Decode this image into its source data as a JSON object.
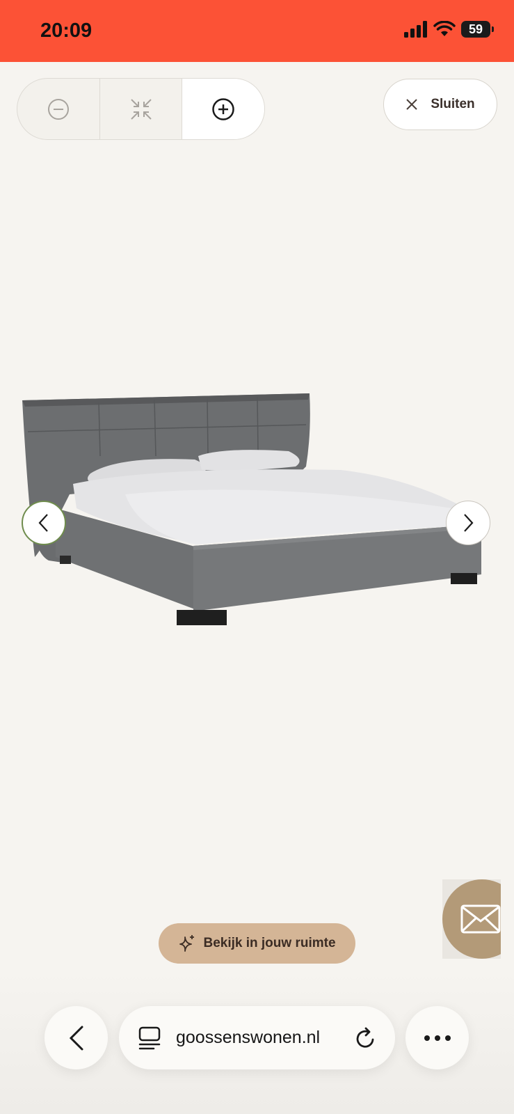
{
  "status_bar": {
    "time": "20:09",
    "battery": "59",
    "background": "#fc5236"
  },
  "viewer": {
    "zoom_controls": {
      "zoom_out_icon": "minus-circle-icon",
      "fit_icon": "collapse-icon",
      "zoom_in_icon": "plus-circle-icon"
    },
    "close_label": "Sluiten",
    "prev_icon": "chevron-left-icon",
    "next_icon": "chevron-right-icon",
    "image_subject": "bed",
    "ar_button_label": "Bekijk in jouw ruimte",
    "ar_icon": "sparkle-icon",
    "contact_icon": "envelope-icon"
  },
  "browser": {
    "url": "goossenswonen.nl",
    "back_icon": "chevron-left-icon",
    "tabs_icon": "tabs-icon",
    "reload_icon": "reload-icon",
    "more_icon": "more-horizontal-icon"
  },
  "colors": {
    "page_bg": "#f6f4f0",
    "ar_button_bg": "#d4b596",
    "contact_bg": "#b39a78",
    "accent_green": "#6f8c4d"
  }
}
